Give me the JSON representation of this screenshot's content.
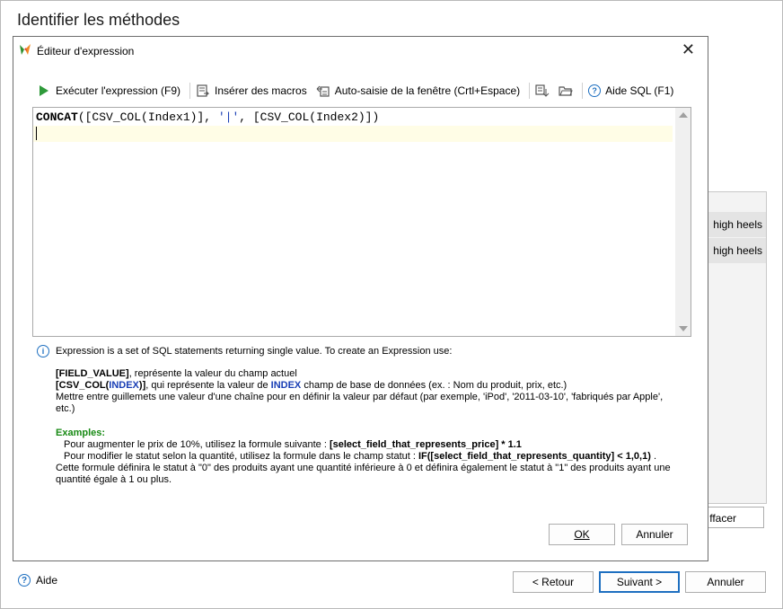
{
  "window": {
    "title": "Identifier les méthodes"
  },
  "background": {
    "rows": [
      "high heels",
      "high heels"
    ],
    "effacer_label": "ffacer"
  },
  "footer": {
    "help_label": "Aide",
    "back_label": "< Retour",
    "next_label": "Suivant >",
    "cancel_label": "Annuler"
  },
  "dialog": {
    "title": "Éditeur d'expression",
    "close_glyph": "✕",
    "toolbar": {
      "execute_label": "Exécuter l'expression (F9)",
      "insert_macros_label": "Insérer des macros",
      "autocomplete_label": "Auto-saisie de la fenêtre (Crtl+Espace)",
      "help_sql_label": "Aide SQL (F1)"
    },
    "editor": {
      "fn": "CONCAT",
      "part1": "([CSV_COL(Index1)], ",
      "literal": "'|'",
      "part2": ", [CSV_COL(Index2)])"
    },
    "info": {
      "intro": "Expression is a set of SQL statements returning single value. To create an Expression use:",
      "field_value_token": "[FIELD_VALUE]",
      "field_value_desc": ", représente la valeur du champ actuel",
      "csv_col_open": "[CSV_COL(",
      "csv_col_index": "INDEX",
      "csv_col_close": ")]",
      "csv_col_desc1": ", qui représente la valeur de ",
      "csv_col_index2": "INDEX",
      "csv_col_desc2": " champ de base de données (ex. : Nom du produit, prix, etc.)",
      "quotes_desc": "Mettre entre guillemets une valeur d'une chaîne pour en définir la valeur par défaut (par exemple, 'iPod', '2011-03-10', 'fabriqués par Apple', etc.)",
      "examples_label": "Examples:",
      "ex1_text": "Pour augmenter le prix de 10%, utilisez la formule suivante : ",
      "ex1_formula": "[select_field_that_represents_price] * 1.1",
      "ex2_text": "Pour modifier le statut selon la quantité, utilisez la formule dans le champ statut : ",
      "ex2_formula": "IF([select_field_that_represents_quantity] < 1,0,1)",
      "ex2_end": " .",
      "ex2_explain": "Cette formule définira le statut à \"0\" des produits ayant une quantité inférieure à 0 et définira également le statut à \"1\" des produits ayant une quantité égale à 1 ou plus."
    },
    "ok_label": "OK",
    "cancel_label": "Annuler"
  }
}
